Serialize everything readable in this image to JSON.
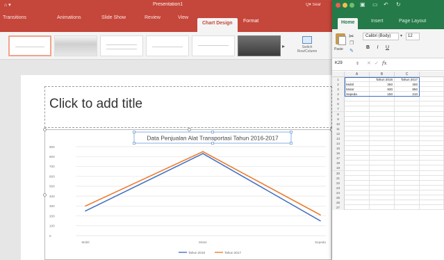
{
  "powerpoint": {
    "title": "Presentation1",
    "quick_access": "⌂ ▾",
    "search": "Q▾ Sear",
    "tabs": [
      {
        "label": "Transitions"
      },
      {
        "label": "Animations"
      },
      {
        "label": "Slide Show"
      },
      {
        "label": "Review"
      },
      {
        "label": "View"
      },
      {
        "label": "Chart Design"
      },
      {
        "label": "Format"
      }
    ],
    "active_tab": "Chart Design",
    "ribbon": {
      "switch_label": "Switch Row/Column",
      "more_arrow": "▸"
    },
    "slide": {
      "title_placeholder": "Click to add title"
    }
  },
  "chart_data": {
    "type": "line",
    "title": "Data Penjualan Alat Transportasi Tahun 2016-2017",
    "categories": [
      "Mobil",
      "Motor",
      "Sepeda"
    ],
    "series": [
      {
        "name": "Tahun 2016",
        "values": [
          250,
          830,
          150
        ],
        "color": "#4472c4"
      },
      {
        "name": "Tahun 2017",
        "values": [
          300,
          850,
          210
        ],
        "color": "#ed7d31"
      }
    ],
    "ylim": [
      0,
      900
    ],
    "yticks": [
      0,
      100,
      200,
      300,
      400,
      500,
      600,
      700,
      800,
      900
    ],
    "grid": true,
    "legend": "bottom"
  },
  "excel": {
    "tabs": [
      {
        "label": "Home"
      },
      {
        "label": "Insert"
      },
      {
        "label": "Page Layout"
      }
    ],
    "active_tab": "Home",
    "ribbon": {
      "paste_label": "Paste",
      "font_name": "Calibri (Body)",
      "font_arrow": "▾",
      "font_size": "12",
      "bold": "B",
      "italic": "I",
      "underline": "U"
    },
    "formula_bar": {
      "name_box": "K29",
      "fx": "fx"
    },
    "columns": [
      "A",
      "B",
      "C"
    ],
    "sheet_rows": [
      [
        "",
        "Tahun 2016",
        "Tahun 2017"
      ],
      [
        "Mobil",
        "250",
        "300"
      ],
      [
        "Motor",
        "830",
        "850"
      ],
      [
        "Sepeda",
        "150",
        "210"
      ]
    ],
    "row_numbers": [
      "1",
      "2",
      "3",
      "4",
      "5",
      "6",
      "7",
      "8",
      "9",
      "10",
      "11",
      "12",
      "13",
      "14",
      "15",
      "16",
      "17",
      "18",
      "19",
      "20",
      "21",
      "22",
      "23",
      "24",
      "25",
      "26",
      "27"
    ],
    "colors": {
      "accent": "#247a48"
    }
  },
  "colors": {
    "powerpoint_accent": "#c5463a",
    "series_2016": "#4472c4",
    "series_2017": "#ed7d31"
  }
}
